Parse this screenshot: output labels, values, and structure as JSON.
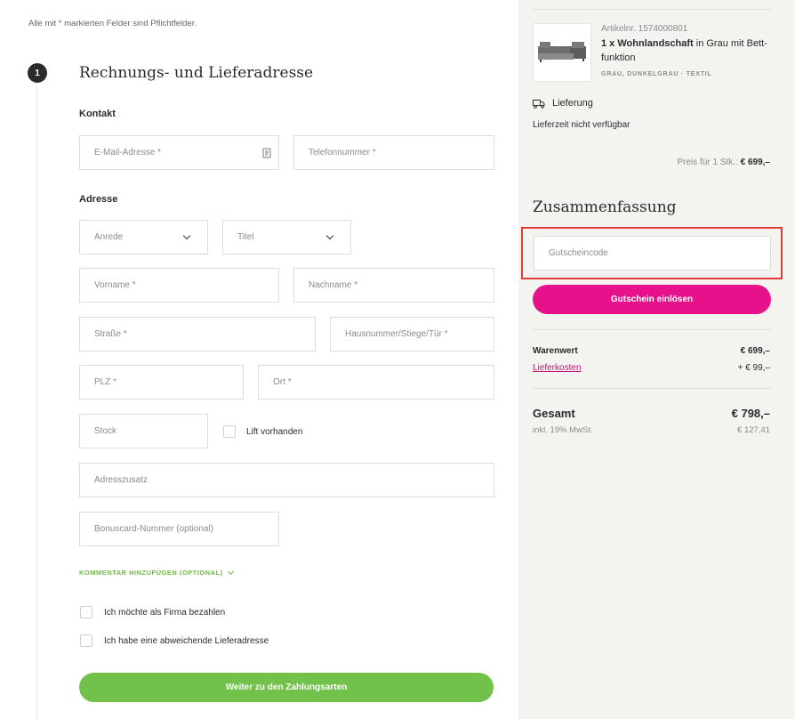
{
  "form": {
    "required_note": "Alle mit * markierten Felder sind Pflichtfelder.",
    "step_number": "1",
    "section_title": "Rechnungs- und Lieferadresse",
    "contact_heading": "Kontakt",
    "address_heading": "Adresse",
    "email_placeholder": "E-Mail-Adresse *",
    "phone_placeholder": "Telefonnummer *",
    "salutation_placeholder": "Anrede",
    "title_placeholder": "Titel",
    "firstname_placeholder": "Vorname *",
    "lastname_placeholder": "Nachname *",
    "street_placeholder": "Straße *",
    "housenumber_placeholder": "Hausnummer/Stiege/Tür *",
    "zip_placeholder": "PLZ *",
    "city_placeholder": "Ort *",
    "floor_placeholder": "Stock",
    "elevator_label": "Lift vorhanden",
    "address_extra_placeholder": "Adresszusatz",
    "bonuscard_placeholder": "Bonuscard-Nummer (optional)",
    "comment_link": "KOMMENTAR HINZUFÜGEN (OPTIONAL)",
    "company_label": "Ich möchte als Firma bezahlen",
    "alt_delivery_label": "Ich habe eine abweichende Lieferadresse",
    "continue_label": "Weiter zu den Zahlungsarten"
  },
  "product": {
    "article_number": "Artikelnr. 1574000801",
    "name_bold": "1 x Wohnlandschaft",
    "name_rest": " in Grau mit Bett-funktion",
    "tags": "GRAU, DUNKELGRAU  ·  TEXTIL",
    "image_icon": "sofa-icon",
    "delivery_label": "Lieferung",
    "delivery_icon": "truck-icon",
    "delivery_note": "Lieferzeit nicht verfügbar",
    "unit_price_label": "Preis für 1 Stk.:",
    "unit_price_value": "€ 699,–"
  },
  "summary": {
    "title": "Zusammenfassung",
    "voucher_placeholder": "Gutscheincode",
    "voucher_button": "Gutschein einlösen",
    "goods_label": "Warenwert",
    "goods_value": "€ 699,–",
    "shipping_label": "Lieferkosten",
    "shipping_value": "+ € 99,–",
    "total_label": "Gesamt",
    "total_value": "€ 798,–",
    "tax_label": "inkl. 19% MwSt.",
    "tax_value": "€ 127,41"
  },
  "colors": {
    "green_accent": "#72c14a",
    "pink_accent": "#e8118c",
    "highlight_red": "#e53a3a",
    "sidebar_bg": "#f3f3ef"
  }
}
